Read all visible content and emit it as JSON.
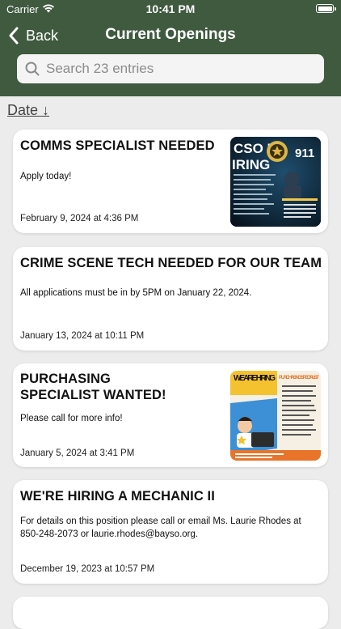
{
  "status_bar": {
    "carrier": "Carrier",
    "time": "10:41 PM"
  },
  "nav": {
    "back_label": "Back",
    "title": "Current Openings"
  },
  "search": {
    "placeholder": "Search 23 entries"
  },
  "sort": {
    "label": "Date ↓"
  },
  "colors": {
    "header_bg": "#3f5a3f",
    "page_bg": "#ececec",
    "card_bg": "#ffffff"
  },
  "listings": [
    {
      "title": "COMMS SPECIALIST NEEDED",
      "description": "Apply today!",
      "date": "February 9, 2024 at 4:36 PM",
      "has_image": true,
      "image": {
        "text_top": "CSO IS",
        "text_hiring": "IRING",
        "text_911": "911"
      }
    },
    {
      "title": "CRIME SCENE TECH NEEDED FOR OUR TEAM",
      "description": "All applications must be in by 5PM on January 22, 2024.",
      "date": "January 13, 2024 at 10:11 PM",
      "has_image": false
    },
    {
      "title_line1": "PURCHASING",
      "title_line2": "SPECIALIST WANTED!",
      "description": "Please call for more info!",
      "date": "January 5, 2024 at 3:41 PM",
      "has_image": true,
      "image": {
        "text_hiring": "WE ARE HIRING",
        "text_role": "PURCHASING SPECIALIST"
      }
    },
    {
      "title": "WE'RE HIRING A MECHANIC II",
      "description_line1": "For details on this position please call or email Ms. Laurie Rhodes at",
      "description_line2": "850-248-2073 or laurie.rhodes@bayso.org.",
      "date": "December 19, 2023 at 10:57 PM",
      "has_image": false
    }
  ]
}
